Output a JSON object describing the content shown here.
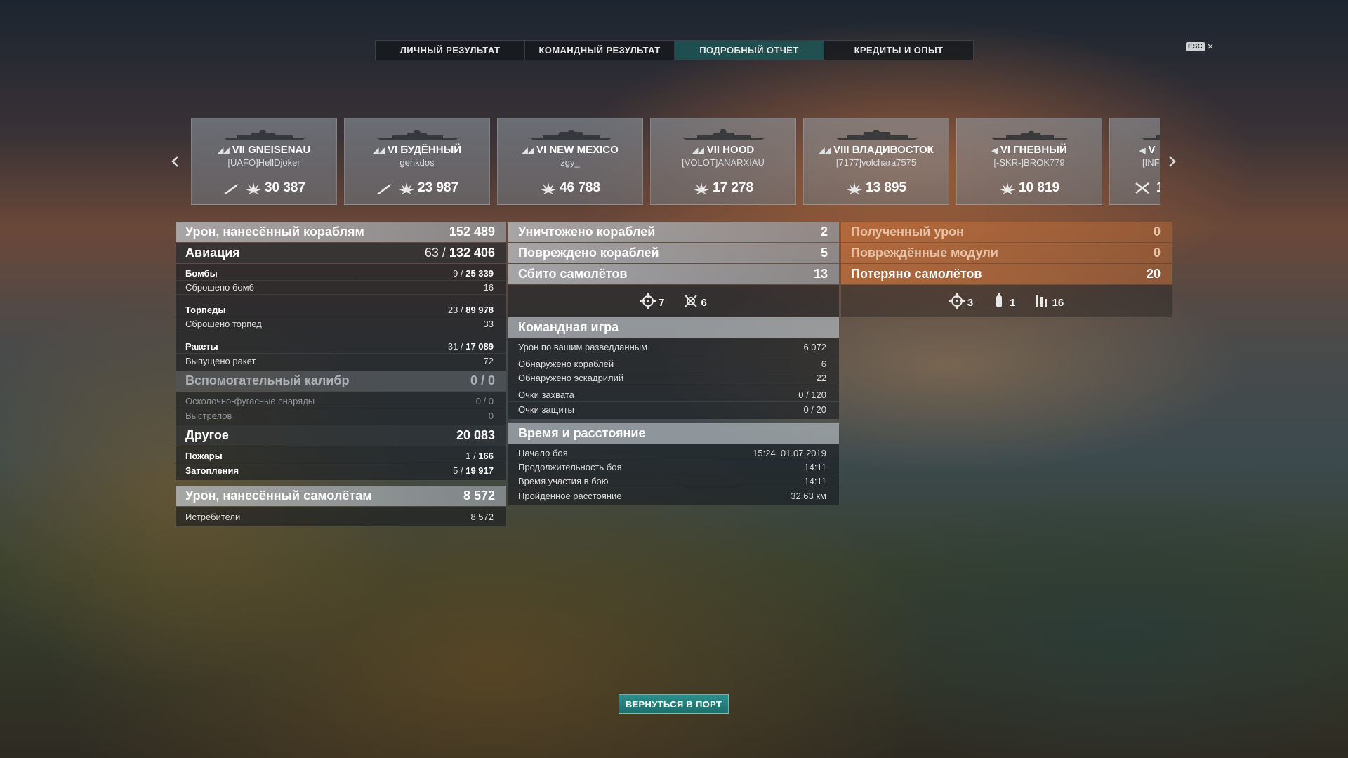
{
  "tabs": [
    {
      "label": "ЛИЧНЫЙ РЕЗУЛЬТАТ",
      "active": false
    },
    {
      "label": "КОМАНДНЫЙ РЕЗУЛЬТАТ",
      "active": false
    },
    {
      "label": "ПОДРОБНЫЙ ОТЧЁТ",
      "active": true
    },
    {
      "label": "КРЕДИТЫ И ОПЫТ",
      "active": false
    }
  ],
  "esc": {
    "key_label": "ESC",
    "close_glyph": "×"
  },
  "carousel": {
    "prev_glyph": "‹",
    "next_glyph": "›",
    "ships": [
      {
        "tier": "VII",
        "name": "GNEISENAU",
        "player": "[UAFO]HellDjoker",
        "damage": "30 387",
        "class_icon": "battleship-icon",
        "extra_icon": "torpedo-icon"
      },
      {
        "tier": "VI",
        "name": "БУДЁННЫЙ",
        "player": "genkdos",
        "damage": "23 987",
        "class_icon": "cruiser-icon",
        "extra_icon": "torpedo-icon"
      },
      {
        "tier": "VI",
        "name": "NEW MEXICO",
        "player": "zgy_",
        "damage": "46 788",
        "class_icon": "battleship-icon",
        "extra_icon": ""
      },
      {
        "tier": "VII",
        "name": "HOOD",
        "player": "[VOLOT]ANARXIAU",
        "damage": "17 278",
        "class_icon": "battleship-icon",
        "extra_icon": ""
      },
      {
        "tier": "VIII",
        "name": "ВЛАДИВОСТОК",
        "player": "[7177]volchara7575",
        "damage": "13 895",
        "class_icon": "battleship-icon",
        "extra_icon": ""
      },
      {
        "tier": "VI",
        "name": "ГНЕВНЫЙ",
        "player": "[-SKR-]BROK779",
        "damage": "10 819",
        "class_icon": "destroyer-icon",
        "extra_icon": ""
      },
      {
        "tier": "V",
        "name": "",
        "player": "[INF",
        "damage": "1",
        "class_icon": "destroyer-icon",
        "extra_icon": "crossed-swords-icon"
      }
    ]
  },
  "left_panel": {
    "damage_ships": {
      "label": "Урон, нанесённый кораблям",
      "value": "152 489"
    },
    "aviation": {
      "label": "Авиация",
      "value_a": "63",
      "value_sep": " / ",
      "value_b": "132 406"
    },
    "aviation_rows": [
      {
        "label": "Бомбы",
        "a": "9",
        "sep": " / ",
        "b": "25 339",
        "bold": true
      },
      {
        "label": "Сброшено бомб",
        "a": "",
        "sep": "",
        "b": "16",
        "bold": false
      },
      {
        "label": "Торпеды",
        "a": "23",
        "sep": " / ",
        "b": "89 978",
        "bold": true
      },
      {
        "label": "Сброшено торпед",
        "a": "",
        "sep": "",
        "b": "33",
        "bold": false
      },
      {
        "label": "Ракеты",
        "a": "31",
        "sep": " / ",
        "b": "17 089",
        "bold": true
      },
      {
        "label": "Выпущено ракет",
        "a": "",
        "sep": "",
        "b": "72",
        "bold": false
      }
    ],
    "secondary": {
      "label": "Вспомогательный калибр",
      "value": "0 / 0"
    },
    "secondary_rows": [
      {
        "label": "Осколочно-фугасные снаряды",
        "value": "0 / 0"
      },
      {
        "label": "Выстрелов",
        "value": "0"
      }
    ],
    "other": {
      "label": "Другое",
      "value": "20 083"
    },
    "other_rows": [
      {
        "label": "Пожары",
        "a": "1",
        "sep": " / ",
        "b": "166"
      },
      {
        "label": "Затопления",
        "a": "5",
        "sep": " / ",
        "b": "19 917"
      }
    ],
    "damage_planes": {
      "label": "Урон, нанесённый самолётам",
      "value": "8 572"
    },
    "planes_rows": [
      {
        "label": "Истребители",
        "value": "8 572"
      }
    ]
  },
  "mid_panel": {
    "destroyed": {
      "label": "Уничтожено кораблей",
      "value": "2"
    },
    "damaged": {
      "label": "Повреждено кораблей",
      "value": "5"
    },
    "shot_down": {
      "label": "Сбито самолётов",
      "value": "13"
    },
    "icons": [
      {
        "icon": "crosshair-icon",
        "value": "7"
      },
      {
        "icon": "plane-crosshair-icon",
        "value": "6"
      }
    ],
    "team_title": "Командная игра",
    "team_rows": [
      {
        "label": "Урон по вашим разведданным",
        "value": "6 072"
      },
      {
        "label": "Обнаружено кораблей",
        "value": "6"
      },
      {
        "label": "Обнаружено эскадрилий",
        "value": "22"
      },
      {
        "label": "Очки захвата",
        "value": "0 / 120"
      },
      {
        "label": "Очки защиты",
        "value": "0 / 20"
      }
    ],
    "time_title": "Время и расстояние",
    "time_rows": [
      {
        "label": "Начало боя",
        "value": "15:24  01.07.2019"
      },
      {
        "label": "Продолжительность боя",
        "value": "14:11"
      },
      {
        "label": "Время участия в бою",
        "value": "14:11"
      },
      {
        "label": "Пройденное расстояние",
        "value": "32.63 км"
      }
    ]
  },
  "right_panel": {
    "received": {
      "label": "Полученный урон",
      "value": "0"
    },
    "modules": {
      "label": "Повреждённые модули",
      "value": "0"
    },
    "lost_planes": {
      "label": "Потеряно самолётов",
      "value": "20"
    },
    "icons": [
      {
        "icon": "crosshair-icon",
        "value": "3"
      },
      {
        "icon": "bomb-icon",
        "value": "1"
      },
      {
        "icon": "flak-icon",
        "value": "16"
      }
    ]
  },
  "return_button": "ВЕРНУТЬСЯ В ПОРТ",
  "colors": {
    "accent": "#2c8f8c",
    "received_panel": "#be6e3c"
  }
}
